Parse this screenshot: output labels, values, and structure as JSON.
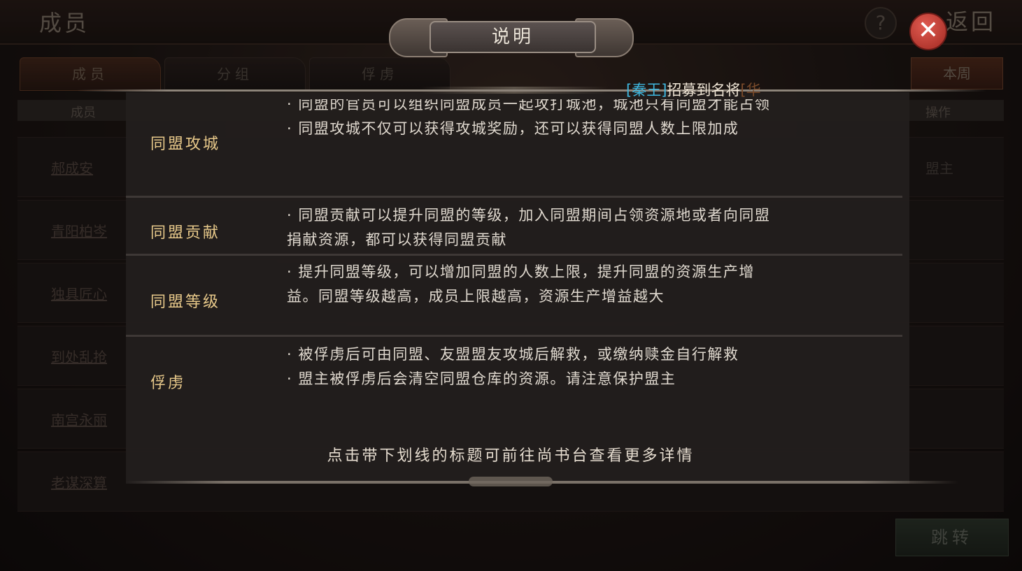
{
  "background": {
    "page_title": "成员",
    "help_label": "?",
    "back_label": "返回",
    "tabs": [
      {
        "label": "成员",
        "active": true
      },
      {
        "label": "分组",
        "active": false
      },
      {
        "label": "俘虏",
        "active": false
      }
    ],
    "week_button": "本周",
    "headers": {
      "member": "成员",
      "action": "操作"
    },
    "rows": [
      {
        "name": "郝成安",
        "role": "盟主"
      },
      {
        "name": "青阳柏岑",
        "role": ""
      },
      {
        "name": "独具匠心",
        "role": ""
      },
      {
        "name": "到处乱抢",
        "role": ""
      },
      {
        "name": "南宫永丽",
        "role": ""
      },
      {
        "name": "老谋深算",
        "role": ""
      }
    ],
    "jump_button": "跳转"
  },
  "dialog": {
    "title": "说明",
    "close_label": "✕",
    "notice": {
      "open": "[",
      "name": "秦王",
      "close": "]",
      "message": "招募到名将",
      "trail": "[华"
    },
    "rows": [
      {
        "title": "同盟攻城",
        "lines": [
          "· 同盟的官员可以组织同盟成员一起攻打城池，城池只有同盟才能占领",
          "· 同盟攻城不仅可以获得攻城奖励，还可以获得同盟人数上限加成"
        ]
      },
      {
        "title": "同盟贡献",
        "lines": [
          "· 同盟贡献可以提升同盟的等级，加入同盟期间占领资源地或者向同盟捐献资源，都可以获得同盟贡献"
        ]
      },
      {
        "title": "同盟等级",
        "lines": [
          "· 提升同盟等级，可以增加同盟的人数上限，提升同盟的资源生产增益。同盟等级越高，成员上限越高，资源生产增益越大"
        ]
      },
      {
        "title": "俘虏",
        "lines": [
          "· 被俘虏后可由同盟、友盟盟友攻城后解救，或缴纳赎金自行解救",
          "· 盟主被俘虏后会清空同盟仓库的资源。请注意保护盟主"
        ]
      }
    ],
    "footer_hint": "点击带下划线的标题可前往尚书台查看更多详情"
  }
}
